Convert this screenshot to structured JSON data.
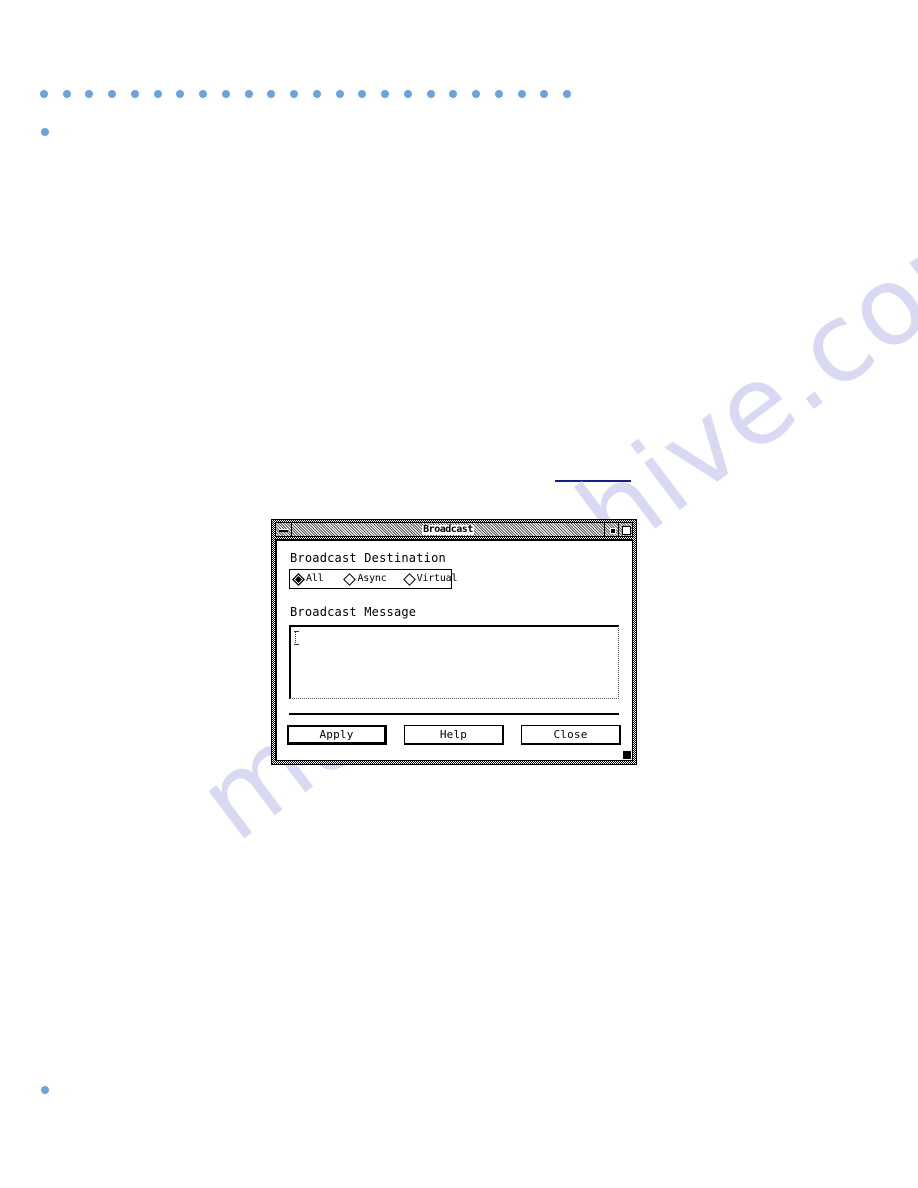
{
  "page": {
    "decor": {
      "top_dot_count": 24,
      "dot_color": "#6aa3dd",
      "rule_color": "#1a1a8c"
    },
    "watermark": {
      "text": "manualshive.com",
      "color": "#d9d9f4"
    }
  },
  "window": {
    "title": "Broadcast",
    "menu_button_icon": "window-menu-icon",
    "minimize_button_icon": "minimize-icon",
    "maximize_button_icon": "maximize-icon",
    "resize_handle_icon": "resize-corner-icon"
  },
  "dialog": {
    "destination": {
      "label": "Broadcast Destination",
      "options": [
        {
          "label": "All",
          "selected": true
        },
        {
          "label": "Async",
          "selected": false
        },
        {
          "label": "Virtual",
          "selected": false
        }
      ]
    },
    "message": {
      "label": "Broadcast Message",
      "value": "",
      "placeholder": ""
    },
    "buttons": [
      {
        "label": "Apply",
        "name": "apply-button",
        "default": true
      },
      {
        "label": "Help",
        "name": "help-button",
        "default": false
      },
      {
        "label": "Close",
        "name": "close-button",
        "default": false
      }
    ]
  }
}
